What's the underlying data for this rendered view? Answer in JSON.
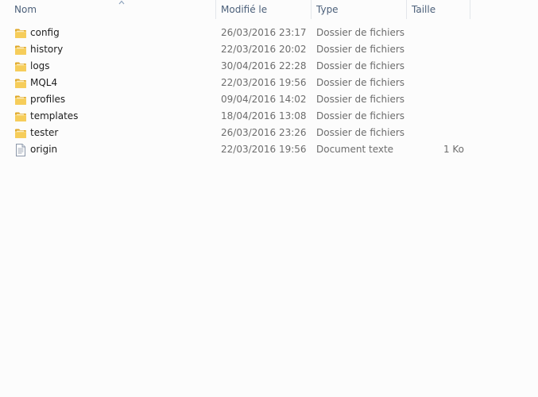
{
  "columns": {
    "name": "Nom",
    "modified": "Modifié le",
    "type": "Type",
    "size": "Taille"
  },
  "sort": {
    "column": "name",
    "direction": "ascending"
  },
  "files": [
    {
      "name": "config",
      "modified": "26/03/2016 23:17",
      "type": "Dossier de fichiers",
      "size": "",
      "icon": "folder-icon"
    },
    {
      "name": "history",
      "modified": "22/03/2016 20:02",
      "type": "Dossier de fichiers",
      "size": "",
      "icon": "folder-icon"
    },
    {
      "name": "logs",
      "modified": "30/04/2016 22:28",
      "type": "Dossier de fichiers",
      "size": "",
      "icon": "folder-icon"
    },
    {
      "name": "MQL4",
      "modified": "22/03/2016 19:56",
      "type": "Dossier de fichiers",
      "size": "",
      "icon": "folder-icon"
    },
    {
      "name": "profiles",
      "modified": "09/04/2016 14:02",
      "type": "Dossier de fichiers",
      "size": "",
      "icon": "folder-icon"
    },
    {
      "name": "templates",
      "modified": "18/04/2016 13:08",
      "type": "Dossier de fichiers",
      "size": "",
      "icon": "folder-icon"
    },
    {
      "name": "tester",
      "modified": "26/03/2016 23:26",
      "type": "Dossier de fichiers",
      "size": "",
      "icon": "folder-icon"
    },
    {
      "name": "origin",
      "modified": "22/03/2016 19:56",
      "type": "Document texte",
      "size": "1 Ko",
      "icon": "text-document-icon"
    }
  ]
}
